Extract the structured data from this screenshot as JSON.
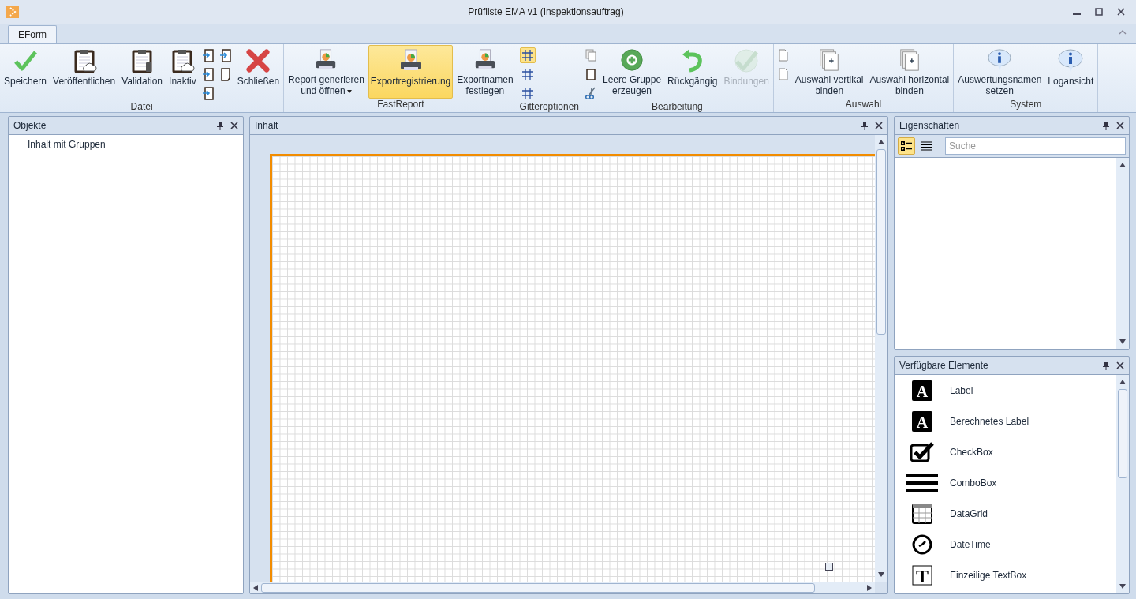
{
  "window": {
    "title": "Prüfliste EMA v1 (Inspektionsauftrag)"
  },
  "tabs": [
    {
      "label": "EForm",
      "selected": true
    }
  ],
  "ribbon": {
    "groups": [
      {
        "label": "Datei",
        "items": [
          {
            "kind": "check",
            "label": "Speichern",
            "selected": false,
            "disabled": false,
            "dropdown": false
          },
          {
            "kind": "cloudboard",
            "label": "Veröffentlichen",
            "selected": false,
            "disabled": false,
            "dropdown": false
          },
          {
            "kind": "clipboard",
            "label": "Validation",
            "selected": false,
            "disabled": false,
            "dropdown": false
          },
          {
            "kind": "cloudboard",
            "label": "Inaktiv",
            "selected": false,
            "disabled": false,
            "dropdown": false
          },
          {
            "kind": "column",
            "items": [
              {
                "kind": "arrowclip",
                "selected": false
              },
              {
                "kind": "arrowclip",
                "selected": false
              },
              {
                "kind": "arrowclip",
                "selected": false
              }
            ]
          },
          {
            "kind": "column",
            "items": [
              {
                "kind": "arrowclip",
                "selected": false
              },
              {
                "kind": "pageclip",
                "selected": false
              }
            ]
          },
          {
            "kind": "cross",
            "label": "Schließen",
            "selected": false,
            "disabled": false,
            "dropdown": false
          }
        ]
      },
      {
        "label": "FastReport",
        "items": [
          {
            "kind": "printer",
            "label": "Report generieren\nund öffnen",
            "selected": false,
            "disabled": false,
            "dropdown": true
          },
          {
            "kind": "printer",
            "label": "Exportregistrierung",
            "selected": true,
            "disabled": false,
            "dropdown": false
          },
          {
            "kind": "printer",
            "label": "Exportnamen\nfestlegen",
            "selected": false,
            "disabled": false,
            "dropdown": false
          }
        ]
      },
      {
        "label": "Gitteroptionen",
        "items": [
          {
            "kind": "column",
            "items": [
              {
                "kind": "grid",
                "selected": true
              },
              {
                "kind": "grid",
                "selected": false
              },
              {
                "kind": "grid",
                "selected": false
              }
            ]
          }
        ]
      },
      {
        "label": "Bearbeitung",
        "items": [
          {
            "kind": "column",
            "items": [
              {
                "kind": "copy",
                "selected": false
              },
              {
                "kind": "paste",
                "selected": false
              },
              {
                "kind": "cut",
                "selected": false
              }
            ]
          },
          {
            "kind": "add",
            "label": "Leere Gruppe\nerzeugen",
            "selected": false,
            "disabled": false,
            "dropdown": false
          },
          {
            "kind": "undo",
            "label": "Rückgängig",
            "selected": false,
            "disabled": false,
            "dropdown": false
          },
          {
            "kind": "check",
            "label": "Bindungen",
            "selected": false,
            "disabled": true,
            "dropdown": false
          }
        ]
      },
      {
        "label": "Auswahl",
        "items": [
          {
            "kind": "column",
            "items": [
              {
                "kind": "page",
                "selected": false
              },
              {
                "kind": "page",
                "selected": false
              }
            ]
          },
          {
            "kind": "pages",
            "label": "Auswahl vertikal\nbinden",
            "selected": false,
            "disabled": false,
            "dropdown": false
          },
          {
            "kind": "pages",
            "label": "Auswahl horizontal\nbinden",
            "selected": false,
            "disabled": false,
            "dropdown": false
          }
        ]
      },
      {
        "label": "System",
        "items": [
          {
            "kind": "info",
            "label": "Auswertungsnamen\nsetzen",
            "selected": false,
            "disabled": false,
            "dropdown": false
          },
          {
            "kind": "info",
            "label": "Logansicht",
            "selected": false,
            "disabled": false,
            "dropdown": false
          }
        ]
      }
    ]
  },
  "objects_panel": {
    "title": "Objekte",
    "tree": [
      {
        "label": "Inhalt mit Gruppen"
      }
    ]
  },
  "content_panel": {
    "title": "Inhalt",
    "zoom": {
      "level": 0.5
    }
  },
  "properties_panel": {
    "title": "Eigenschaften",
    "views": [
      {
        "kind": "categorized",
        "selected": true
      },
      {
        "kind": "list",
        "selected": false
      }
    ],
    "search": {
      "placeholder": "Suche"
    }
  },
  "elements_panel": {
    "title": "Verfügbare Elemente",
    "items": [
      {
        "kind": "letter",
        "glyph": "A",
        "label": "Label"
      },
      {
        "kind": "letter",
        "glyph": "A",
        "label": "Berechnetes Label"
      },
      {
        "kind": "checkbox",
        "label": "CheckBox"
      },
      {
        "kind": "lines",
        "label": "ComboBox"
      },
      {
        "kind": "table",
        "label": "DataGrid"
      },
      {
        "kind": "clock",
        "label": "DateTime"
      },
      {
        "kind": "textbox",
        "glyph": "T",
        "label": "Einzeilige TextBox"
      }
    ]
  }
}
